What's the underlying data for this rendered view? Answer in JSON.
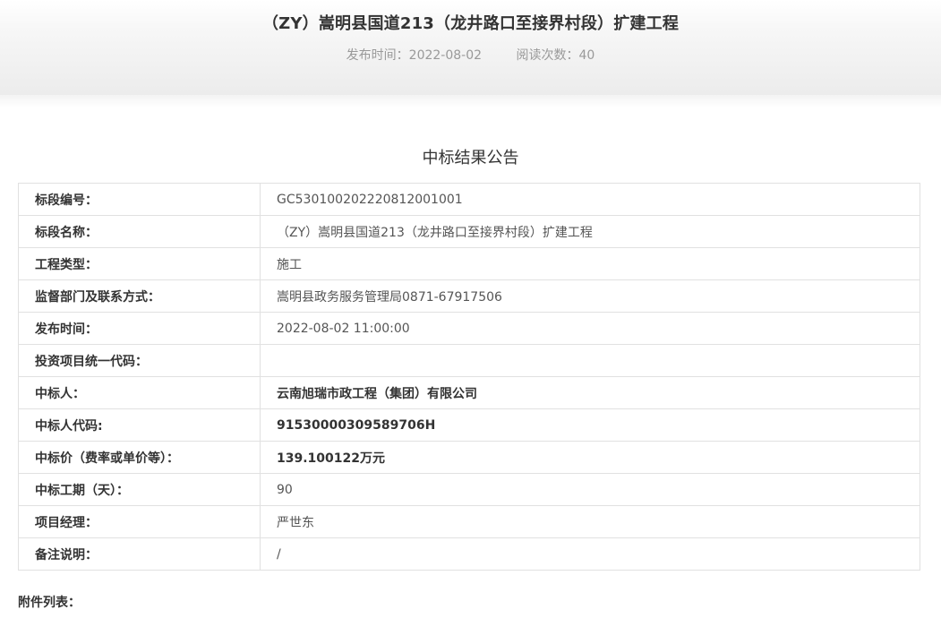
{
  "header": {
    "title": "（ZY）嵩明县国道213（龙井路口至接界村段）扩建工程",
    "publish_time": "发布时间：2022-08-02",
    "read_count": "阅读次数：40"
  },
  "notice": {
    "title": "中标结果公告"
  },
  "rows": [
    {
      "label": "标段编号：",
      "value": "GC5301002022208120010 01"
    },
    {
      "label": "标段名称：",
      "value": "（ZY）嵩明县国道213（龙井路口至接界村段）扩建工程"
    },
    {
      "label": "工程类型：",
      "value": "施工"
    },
    {
      "label": "监督部门及联系方式：",
      "value": "嵩明县政务服务管理局0871-67917506"
    },
    {
      "label": "发布时间：",
      "value": "2022-08-02 11:00:00"
    },
    {
      "label": "投资项目统一代码：",
      "value": ""
    },
    {
      "label": "中标人：",
      "value": "云南旭瑞市政工程（集团）有限公司"
    },
    {
      "label": "中标人代码:",
      "value": "91530000309589706H"
    },
    {
      "label": "中标价（费率或单价等）：",
      "value": "139.100122万元"
    },
    {
      "label": "中标工期（天）：",
      "value": "90"
    },
    {
      "label": "项目经理：",
      "value": "严世东"
    },
    {
      "label": "备注说明：",
      "value": "/"
    }
  ],
  "attachments": {
    "label": "附件列表："
  }
}
